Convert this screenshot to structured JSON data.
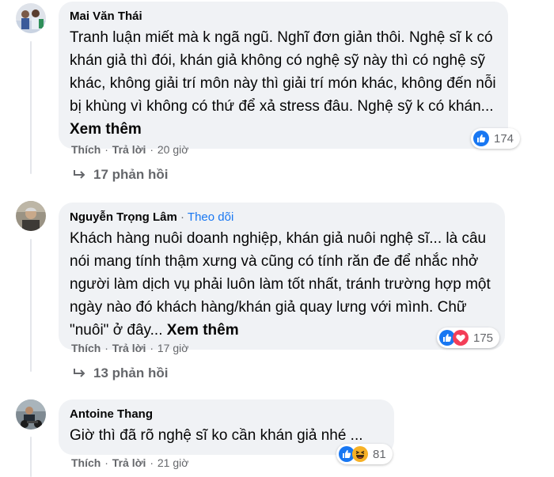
{
  "comments": [
    {
      "author": "Mai Văn Thái",
      "text": "Tranh luận miết mà k ngã ngũ. Nghĩ đơn giản thôi. Nghệ sĩ k có khán giả thì đói, khán giả không có nghệ sỹ này thì có nghệ sỹ khác, không giải trí môn này thì giải trí món khác, không đến nỗi bị khùng vì không có thứ để xả stress đâu. Nghệ sỹ k có khán...",
      "see_more": "Xem thêm",
      "like": "Thích",
      "reply": "Trả lời",
      "time": "20 giờ",
      "reaction_count": "174",
      "reaction_icons": [
        "like-icon"
      ],
      "replies_label": "17 phản hồi"
    },
    {
      "author": "Nguyễn Trọng Lâm",
      "follow": "Theo dõi",
      "text": "Khách hàng nuôi doanh nghiệp, khán giả nuôi nghệ sĩ... là câu nói mang tính thậm xưng và cũng có tính răn đe để nhắc nhở người làm dịch vụ phải luôn làm tốt nhất, tránh trường hợp một ngày nào đó khách hàng/khán giả quay lưng với mình. Chữ \"nuôi\" ở đây...",
      "see_more": "Xem thêm",
      "like": "Thích",
      "reply": "Trả lời",
      "time": "17 giờ",
      "reaction_count": "175",
      "reaction_icons": [
        "like-icon",
        "love-icon"
      ],
      "replies_label": "13 phản hồi"
    },
    {
      "author": "Antoine Thang",
      "text": "Giờ thì đã rõ nghệ sĩ ko cần khán giả nhé ...",
      "like": "Thích",
      "reply": "Trả lời",
      "time": "21 giờ",
      "reaction_count": "81",
      "reaction_icons": [
        "like-icon",
        "haha-icon"
      ]
    }
  ],
  "colors": {
    "bubble": "#f0f2f5",
    "meta_text": "#65676b",
    "link_blue": "#1877f2",
    "love_red": "#f33e58",
    "haha_yellow": "#f7b125"
  }
}
